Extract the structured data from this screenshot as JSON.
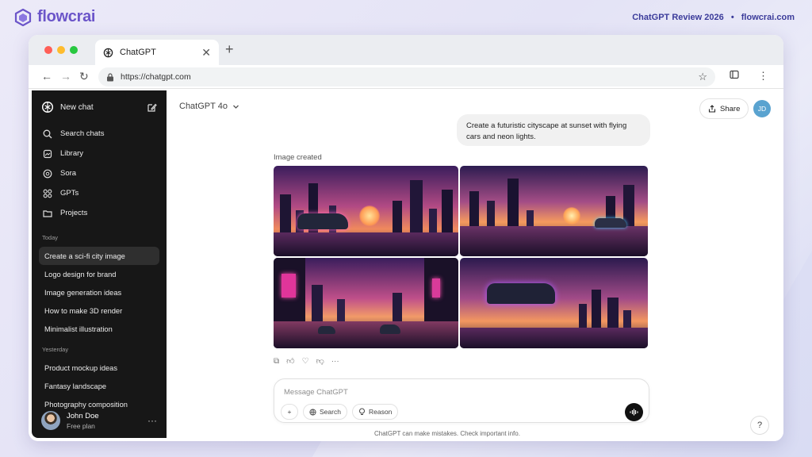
{
  "brand": {
    "name": "flowcrai"
  },
  "header_right": {
    "review": "ChatGPT Review 2026",
    "separator": "•",
    "site": "flowcrai.com"
  },
  "browser": {
    "tab_title": "ChatGPT",
    "tab_close": "✕",
    "new_tab": "+",
    "url": "https://chatgpt.com",
    "lights": [
      "#ff5f57",
      "#febc2e",
      "#28c840"
    ]
  },
  "sidebar": {
    "new_chat": "New chat",
    "nav": [
      {
        "label": "Search chats",
        "icon": "search-icon"
      },
      {
        "label": "Library",
        "icon": "library-icon"
      },
      {
        "label": "Sora",
        "icon": "sora-icon"
      },
      {
        "label": "GPTs",
        "icon": "gpts-icon"
      },
      {
        "label": "Projects",
        "icon": "projects-icon"
      }
    ],
    "today_label": "Today",
    "today": [
      "Create a sci-fi city image",
      "Logo design for brand",
      "Image generation ideas",
      "How to make 3D render",
      "Minimalist illustration"
    ],
    "yesterday_label": "Yesterday",
    "yesterday": [
      "Product mockup ideas",
      "Fantasy landscape",
      "Photography composition"
    ],
    "user": {
      "name": "John Doe",
      "plan": "Free plan",
      "more": "···"
    }
  },
  "main": {
    "model": "ChatGPT 4o",
    "share": "Share",
    "avatar_initials": "JD",
    "user_message": "Create a futuristic cityscape at sunset with flying cars and neon lights.",
    "image_label": "Image created",
    "composer_placeholder": "Message ChatGPT",
    "search_btn": "Search",
    "reason_btn": "Reason",
    "disclaimer": "ChatGPT can make mistakes. Check important info.",
    "help": "?"
  },
  "colors": {
    "accent": "#6b55c9",
    "sidebar_bg": "#171717",
    "avatar": "#5aa3d0"
  }
}
